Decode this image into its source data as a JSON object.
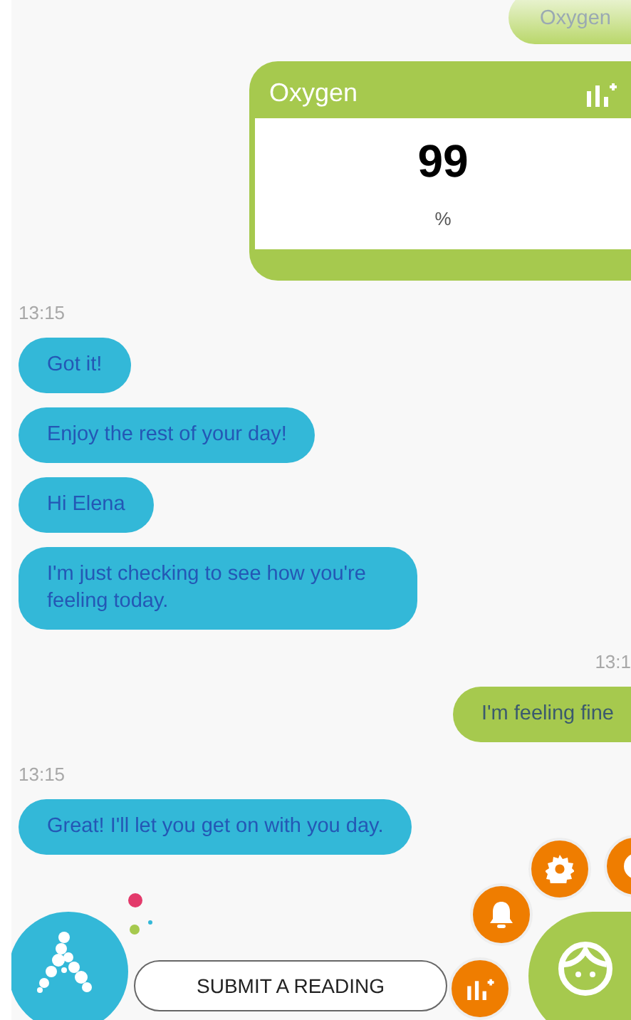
{
  "messages": [
    {
      "kind": "text",
      "outgoing": true,
      "faded": true,
      "text": "Oxygen"
    },
    {
      "kind": "card",
      "outgoing": true,
      "title": "Oxygen",
      "value": "99",
      "unit": "%"
    },
    {
      "kind": "time",
      "outgoing": false,
      "text": "13:15"
    },
    {
      "kind": "text",
      "outgoing": false,
      "faded": false,
      "text": "Got it!"
    },
    {
      "kind": "text",
      "outgoing": false,
      "faded": false,
      "text": "Enjoy the rest of your day!"
    },
    {
      "kind": "text",
      "outgoing": false,
      "faded": false,
      "text": "Hi Elena"
    },
    {
      "kind": "text",
      "outgoing": false,
      "faded": false,
      "text": "I'm just checking to see how you're feeling today."
    },
    {
      "kind": "time",
      "outgoing": true,
      "text": "13:1"
    },
    {
      "kind": "text",
      "outgoing": true,
      "faded": false,
      "text": "I'm feeling fine"
    },
    {
      "kind": "time",
      "outgoing": false,
      "text": "13:15"
    },
    {
      "kind": "text",
      "outgoing": false,
      "faded": false,
      "text": "Great! I'll let you get on with you day."
    }
  ],
  "submit_button": "SUBMIT A READING"
}
